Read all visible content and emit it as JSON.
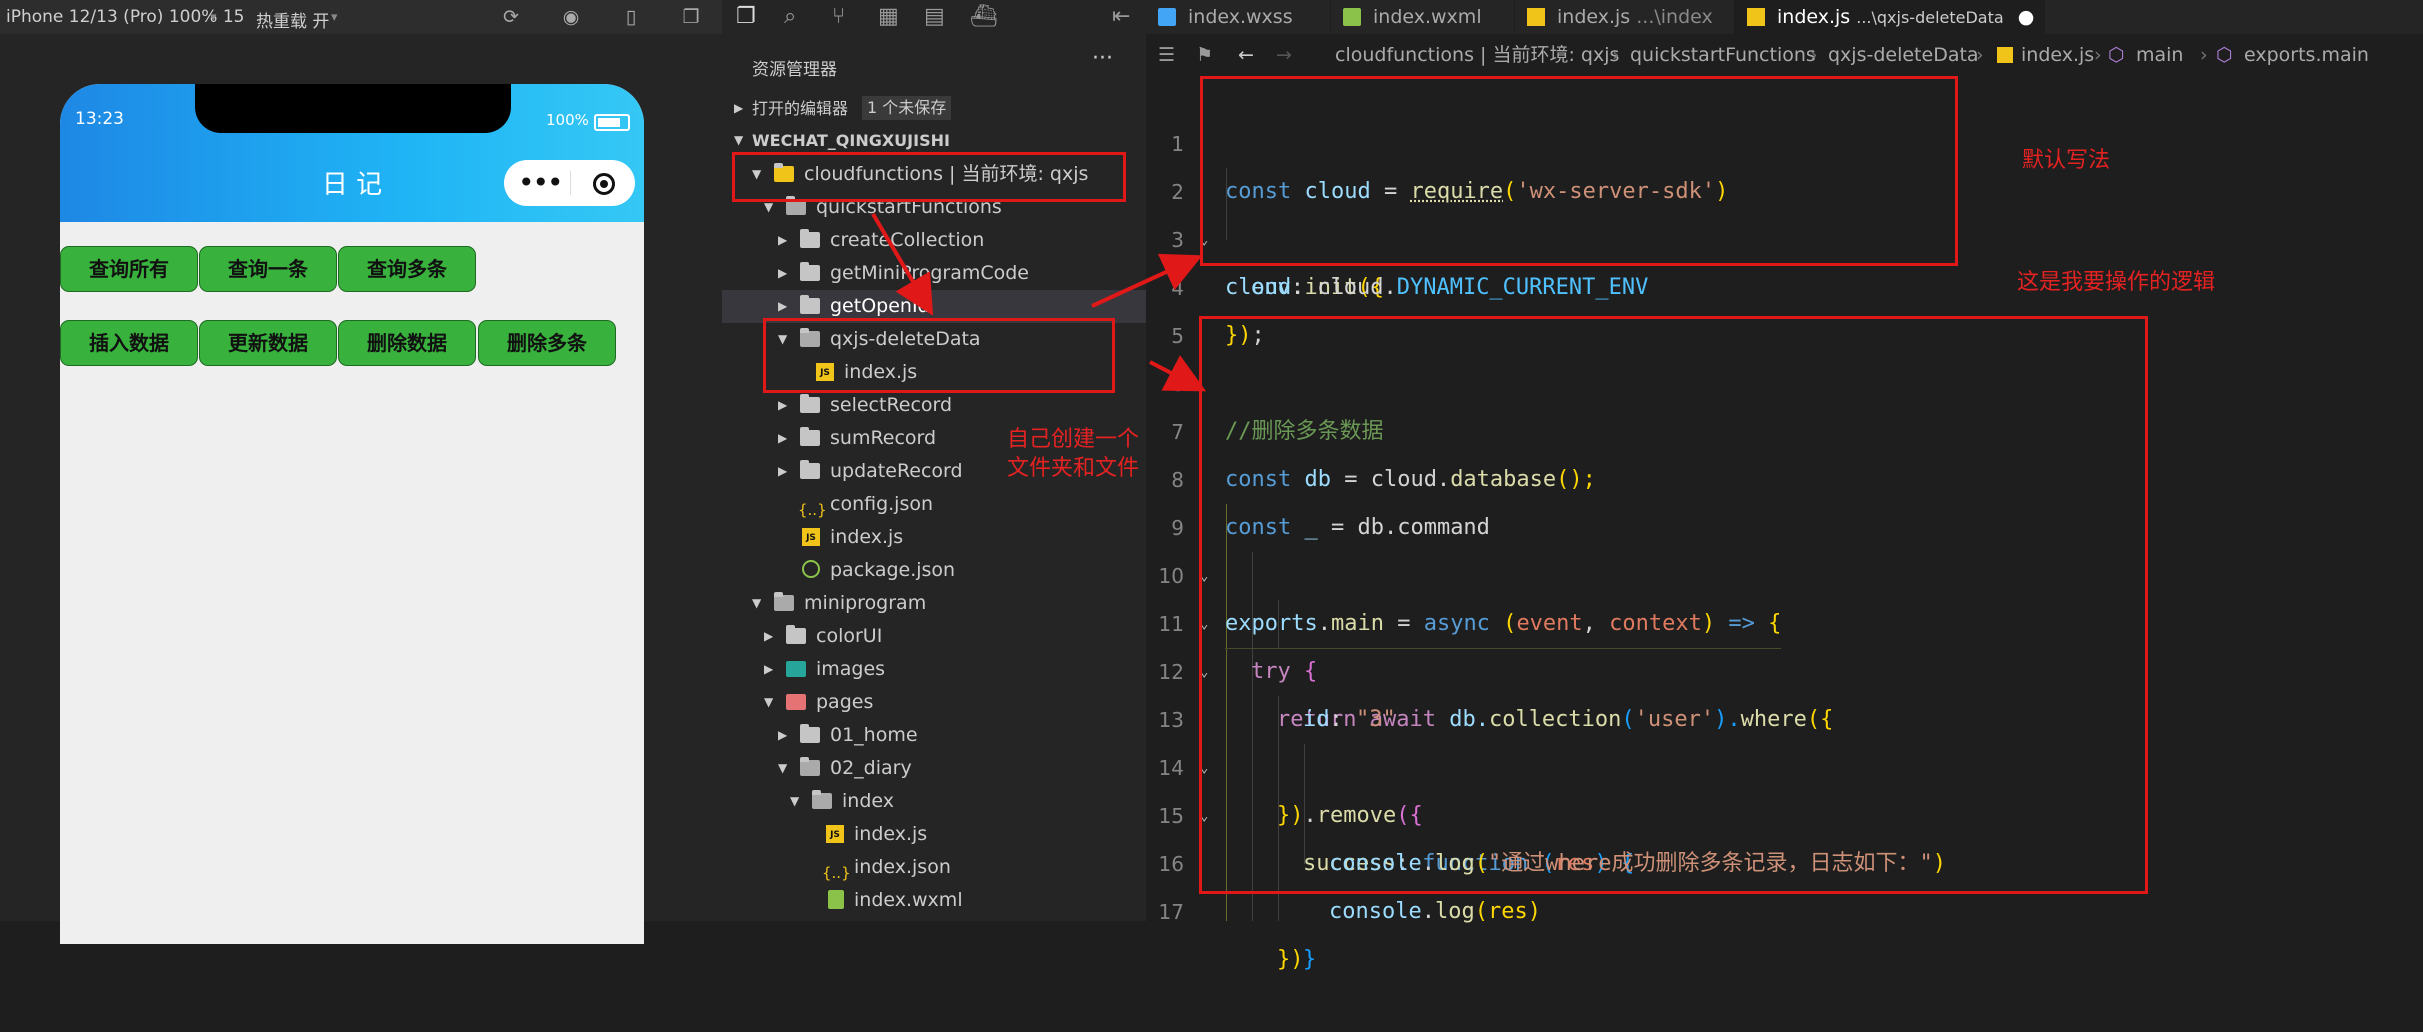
{
  "simulator": {
    "device_label": "iPhone 12/13 (Pro) 100% 15",
    "hot_reload_label": "热重载 开",
    "status_time": "13:23",
    "battery_pct": "100%",
    "nav_title": "日 记",
    "buttons_row1": [
      "查询所有",
      "查询一条",
      "查询多条"
    ],
    "buttons_row2": [
      "插入数据",
      "更新数据",
      "删除数据",
      "删除多条"
    ]
  },
  "explorer": {
    "title": "资源管理器",
    "more": "···",
    "open_editors": "打开的编辑器",
    "unsaved_badge": "1 个未保存",
    "root": "WECHAT_QINGXUJISHI",
    "tree": [
      "cloudfunctions | 当前环境: qxjs",
      "quickstartFunctions",
      "createCollection",
      "getMiniProgramCode",
      "getOpenId",
      "qxjs-deleteData",
      "index.js",
      "selectRecord",
      "sumRecord",
      "updateRecord",
      "config.json",
      "index.js",
      "package.json",
      "miniprogram",
      "colorUI",
      "images",
      "pages",
      "01_home",
      "02_diary",
      "index",
      "index.js",
      "index.json",
      "index.wxml"
    ]
  },
  "editor": {
    "tabs": [
      {
        "name": "index.wxss",
        "path": ""
      },
      {
        "name": "index.wxml",
        "path": ""
      },
      {
        "name": "index.js",
        "path": "...\\index"
      },
      {
        "name": "index.js",
        "path": "...\\qxjs-deleteData"
      }
    ],
    "breadcrumb": [
      "cloudfunctions | 当前环境: qxjs",
      "quickstartFunctions",
      "qxjs-deleteData",
      "index.js",
      "main",
      "exports.main"
    ],
    "line_numbers": [
      "1",
      "2",
      "3",
      "4",
      "5",
      "6",
      "7",
      "8",
      "9",
      "10",
      "11",
      "12",
      "13",
      "14",
      "15",
      "16",
      "17"
    ],
    "code": {
      "l1_a": "const",
      "l1_b": " cloud ",
      "l1_c": "=",
      "l1_d": "require",
      "l1_e": "(",
      "l1_f": "'wx-server-sdk'",
      "l1_g": ")",
      "l2_a": "cloud",
      "l2_b": ".",
      "l2_c": "init",
      "l2_d": "({",
      "l3_a": "env",
      "l3_b": ": cloud.",
      "l3_c": "DYNAMIC_CURRENT_ENV",
      "l4_a": "})",
      "l4_b": ";",
      "l6": "//删除多条数据",
      "l7_a": "const",
      "l7_b": " db ",
      "l7_c": "= cloud.",
      "l7_d": "database",
      "l7_e": "();",
      "l8_a": "const",
      "l8_b": " _ ",
      "l8_c": "= db.command",
      "l9_a": "exports",
      "l9_b": ".",
      "l9_c": "main",
      "l9_d": " = ",
      "l9_e": "async",
      "l9_f": " (",
      "l9_g": "event",
      "l9_h": ", ",
      "l9_i": "context",
      "l9_j": ") ",
      "l9_k": "=>",
      "l9_l": " {",
      "l10_a": "try",
      "l10_b": " {",
      "l11_a": "return",
      "l11_b": " ",
      "l11_c": "await",
      "l11_d": " db.",
      "l11_e": "collection",
      "l11_f": "(",
      "l11_g": "'user'",
      "l11_h": ").",
      "l11_i": "where",
      "l11_j": "({",
      "l12_a": "id",
      "l12_b": ": ",
      "l12_c": "\"3\"",
      "l13_a": "})",
      "l13_b": ".",
      "l13_c": "remove",
      "l13_d": "({",
      "l14_a": "success",
      "l14_b": ": ",
      "l14_c": "function",
      "l14_d": " (",
      "l14_e": "res",
      "l14_f": ") ",
      "l14_g": "{",
      "l15_a": "console",
      "l15_b": ".",
      "l15_c": "log",
      "l15_d": "(",
      "l15_e": "\"通过where成功删除多条记录，日志如下：\"",
      "l15_f": ")",
      "l16_a": "console",
      "l16_b": ".",
      "l16_c": "log",
      "l16_d": "(res)",
      "l17": "}",
      "l18": "})"
    }
  },
  "annotations": {
    "default_style": "默认写法",
    "my_logic": "这是我要操作的逻辑",
    "self_created_1": "自己创建一个",
    "self_created_2": "文件夹和文件"
  },
  "colors": {
    "annotation_red": "#e01818",
    "button_green": "#38b13d",
    "nav_blue": "#1e88e5"
  }
}
